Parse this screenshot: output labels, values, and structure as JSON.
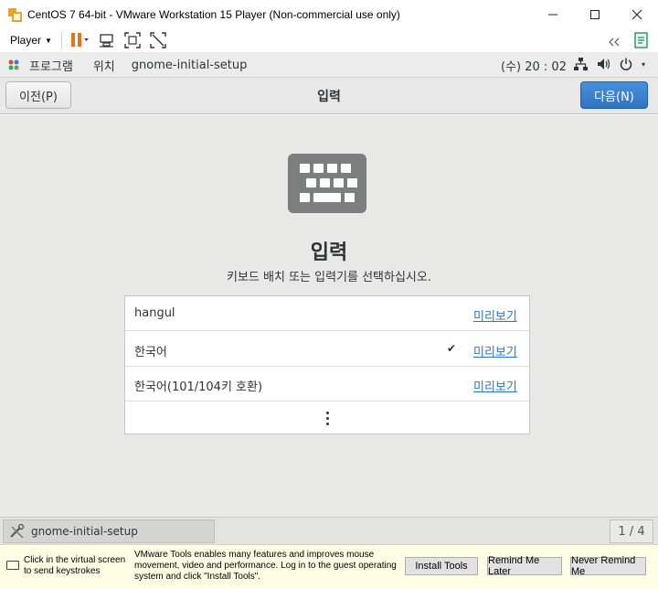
{
  "window": {
    "title": "CentOS 7 64-bit - VMware Workstation 15 Player (Non-commercial use only)",
    "controls": [
      "minimize",
      "maximize",
      "close"
    ]
  },
  "vm_toolbar": {
    "player_label": "Player",
    "icons": [
      "pause-icon",
      "send-ctrl-alt-del-icon",
      "fullscreen-icon",
      "unity-icon"
    ],
    "right_icons": [
      "collapse-icon",
      "notes-icon"
    ]
  },
  "gnome_top": {
    "applications_label": "프로그램",
    "places_label": "위치",
    "app_label": "gnome-initial-setup",
    "clock": "(수) 20 : 02",
    "sys_icons": [
      "network-icon",
      "volume-icon",
      "power-icon"
    ]
  },
  "header": {
    "prev_label": "이전(P)",
    "title": "입력",
    "next_label": "다음(N)"
  },
  "main": {
    "heading": "입력",
    "subtitle": "키보드 배치 또는 입력기를 선택하십시오.",
    "layouts": [
      {
        "name": "hangul",
        "selected": false,
        "preview_label": "미리보기"
      },
      {
        "name": "한국어",
        "selected": true,
        "check": "✔",
        "preview_label": "미리보기"
      },
      {
        "name": "한국어(101/104키 호환)",
        "selected": false,
        "preview_label": "미리보기"
      }
    ],
    "more_icon": "more-vertical-icon"
  },
  "gnome_bottom": {
    "task_label": "gnome-initial-setup",
    "workspace": "1 / 4"
  },
  "notify": {
    "hint": "Click in the virtual screen to send keystrokes",
    "message": "VMware Tools enables many features and improves mouse movement, video and performance. Log in to the guest operating system and click \"Install Tools\".",
    "install_label": "Install Tools",
    "remind_label": "Remind Me Later",
    "never_label": "Never Remind Me"
  },
  "colors": {
    "next_button": "#3584e4",
    "link": "#2a76c6",
    "notify_bg": "#fffde3",
    "pause_orange": "#e8731a"
  }
}
